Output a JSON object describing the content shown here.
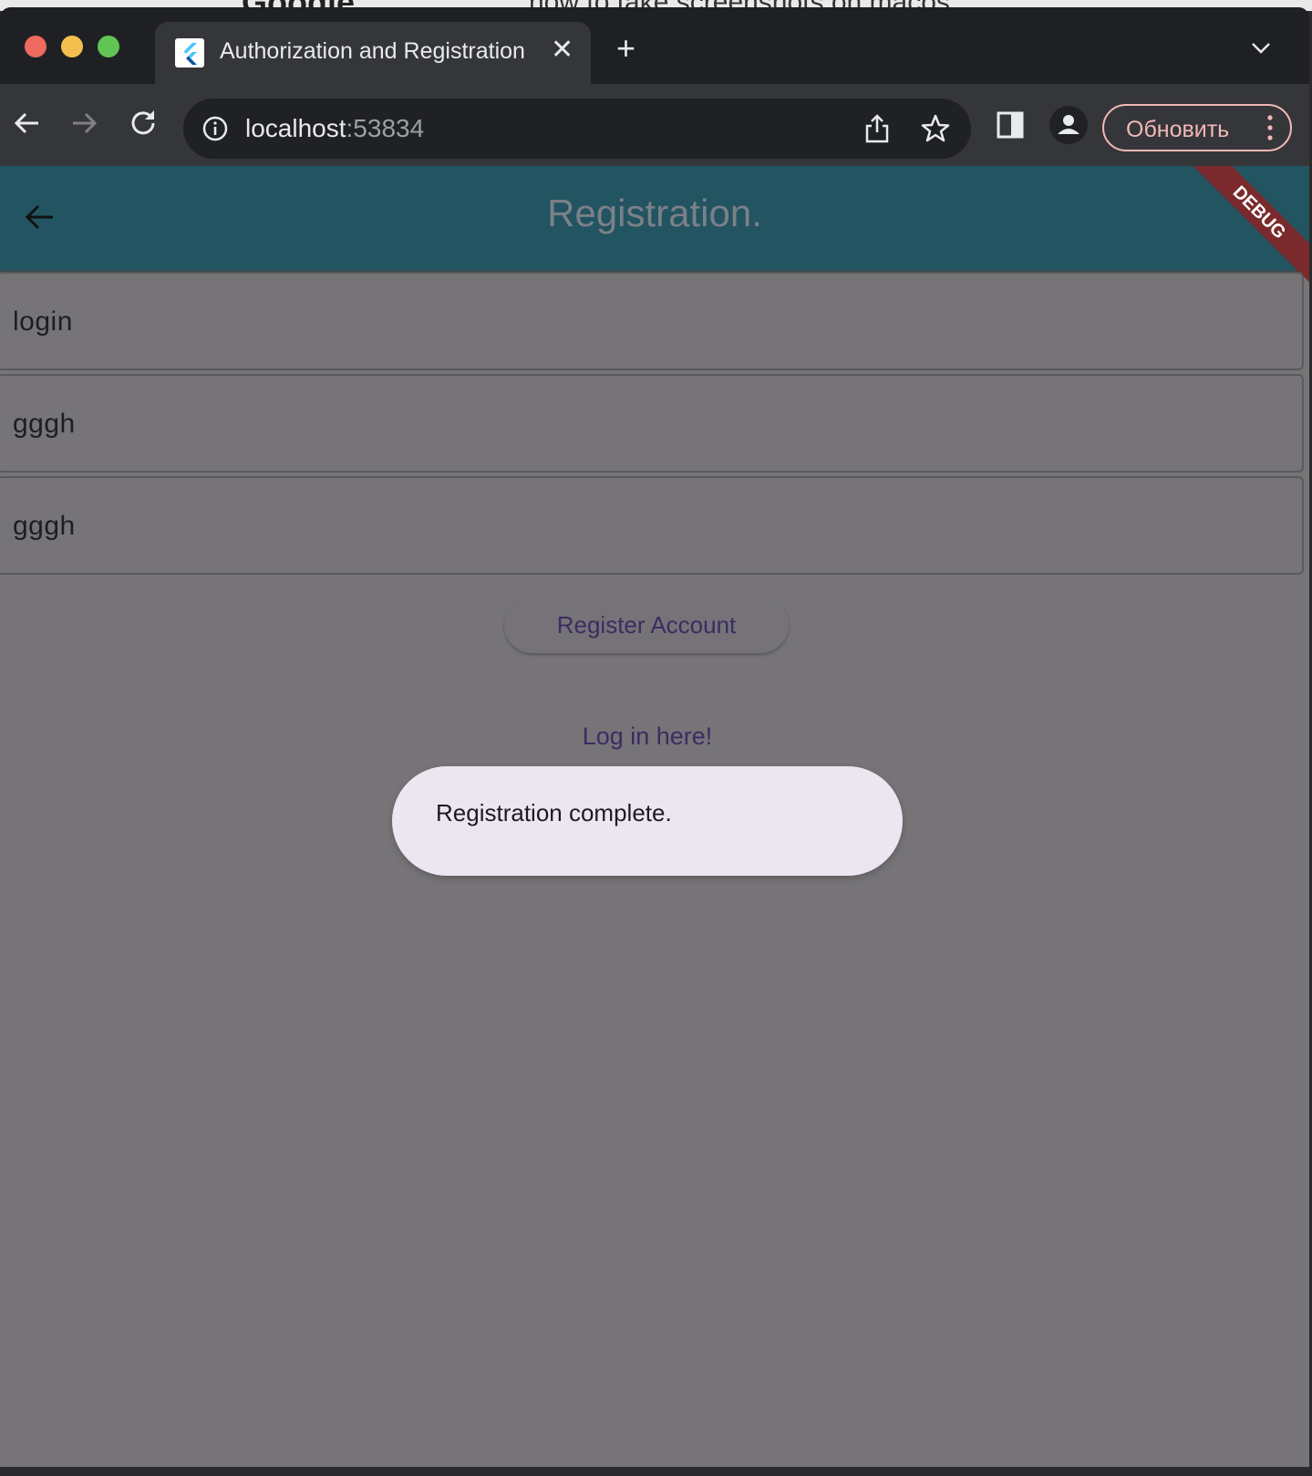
{
  "backdrop": {
    "logo": "Google",
    "text": "how to take screenshots on macos"
  },
  "browser": {
    "tab_title": "Authorization and Registration",
    "tab_close": "✕",
    "new_tab": "+",
    "url_host": "localhost",
    "url_port": ":53834",
    "update_label": "Обновить"
  },
  "app": {
    "title": "Registration.",
    "debug_banner": "DEBUG",
    "fields": {
      "login": "login",
      "password": "gggh",
      "password_confirm": "gggh"
    },
    "register_button": "Register Account",
    "login_link": "Log in here!",
    "snackbar": "Registration complete."
  }
}
